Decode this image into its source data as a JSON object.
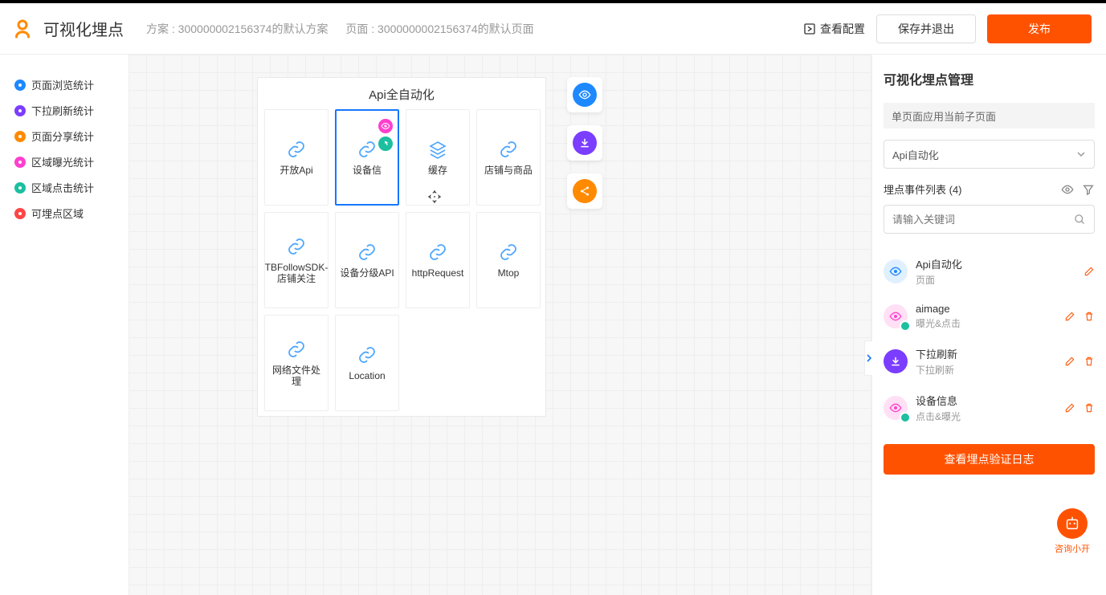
{
  "header": {
    "app_title": "可视化埋点",
    "scheme_label": "方案 : 300000002156374的默认方案",
    "page_label": "页面 : 3000000002156374的默认页面",
    "view_config": "查看配置",
    "save_exit": "保存并退出",
    "publish": "发布"
  },
  "sidebar": [
    {
      "label": "页面浏览统计",
      "color": "sd-blue"
    },
    {
      "label": "下拉刷新统计",
      "color": "sd-purple"
    },
    {
      "label": "页面分享统计",
      "color": "sd-orange"
    },
    {
      "label": "区域曝光统计",
      "color": "sd-pink"
    },
    {
      "label": "区域点击统计",
      "color": "sd-teal"
    },
    {
      "label": "可埋点区域",
      "color": "sd-red"
    }
  ],
  "panel": {
    "title": "Api全自动化",
    "cards": [
      {
        "label": "开放Api"
      },
      {
        "label": "设备信",
        "selected": true,
        "badges": true
      },
      {
        "label": "缓存",
        "stack": true
      },
      {
        "label": "店铺与商品"
      },
      {
        "label": "TBFollowSDK-店铺关注"
      },
      {
        "label": "设备分级API"
      },
      {
        "label": "httpRequest"
      },
      {
        "label": "Mtop"
      },
      {
        "label": "网络文件处理"
      },
      {
        "label": "Location"
      }
    ]
  },
  "rpanel": {
    "title": "可视化埋点管理",
    "subpage": "单页面应用当前子页面",
    "select_value": "Api自动化",
    "list_header": "埋点事件列表 (4)",
    "search_placeholder": "请输入关键词",
    "events": [
      {
        "title": "Api自动化",
        "sub": "页面",
        "ic": "tc-blue",
        "del": false
      },
      {
        "title": "aimage",
        "sub": "曝光&点击",
        "ic": "pink-teal",
        "del": true
      },
      {
        "title": "下拉刷新",
        "sub": "下拉刷新",
        "ic": "tc-purple",
        "del": true
      },
      {
        "title": "设备信息",
        "sub": "点击&曝光",
        "ic": "pink-teal",
        "del": true
      }
    ],
    "verify_btn": "查看埋点验证日志",
    "helper": "咨询小开"
  }
}
